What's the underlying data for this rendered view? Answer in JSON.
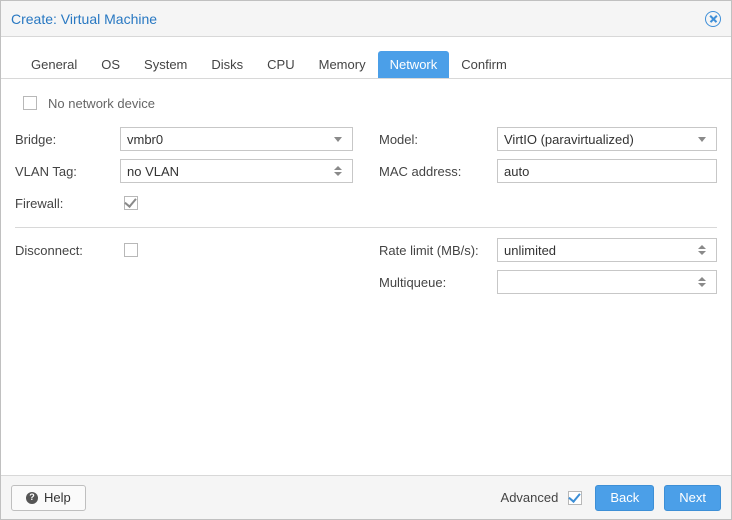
{
  "window": {
    "title": "Create: Virtual Machine"
  },
  "tabs": {
    "items": [
      {
        "label": "General"
      },
      {
        "label": "OS"
      },
      {
        "label": "System"
      },
      {
        "label": "Disks"
      },
      {
        "label": "CPU"
      },
      {
        "label": "Memory"
      },
      {
        "label": "Network"
      },
      {
        "label": "Confirm"
      }
    ],
    "active_index": 6
  },
  "no_network": {
    "label": "No network device",
    "checked": false
  },
  "left": {
    "bridge": {
      "label": "Bridge:",
      "value": "vmbr0"
    },
    "vlan": {
      "label": "VLAN Tag:",
      "value": "no VLAN"
    },
    "firewall": {
      "label": "Firewall:",
      "checked": true
    },
    "disconnect": {
      "label": "Disconnect:",
      "checked": false
    }
  },
  "right": {
    "model": {
      "label": "Model:",
      "value": "VirtIO (paravirtualized)"
    },
    "mac": {
      "label": "MAC address:",
      "value": "auto"
    },
    "rate": {
      "label": "Rate limit (MB/s):",
      "value": "unlimited"
    },
    "multiq": {
      "label": "Multiqueue:",
      "value": ""
    }
  },
  "footer": {
    "help": "Help",
    "advanced": "Advanced",
    "advanced_checked": true,
    "back": "Back",
    "next": "Next"
  }
}
